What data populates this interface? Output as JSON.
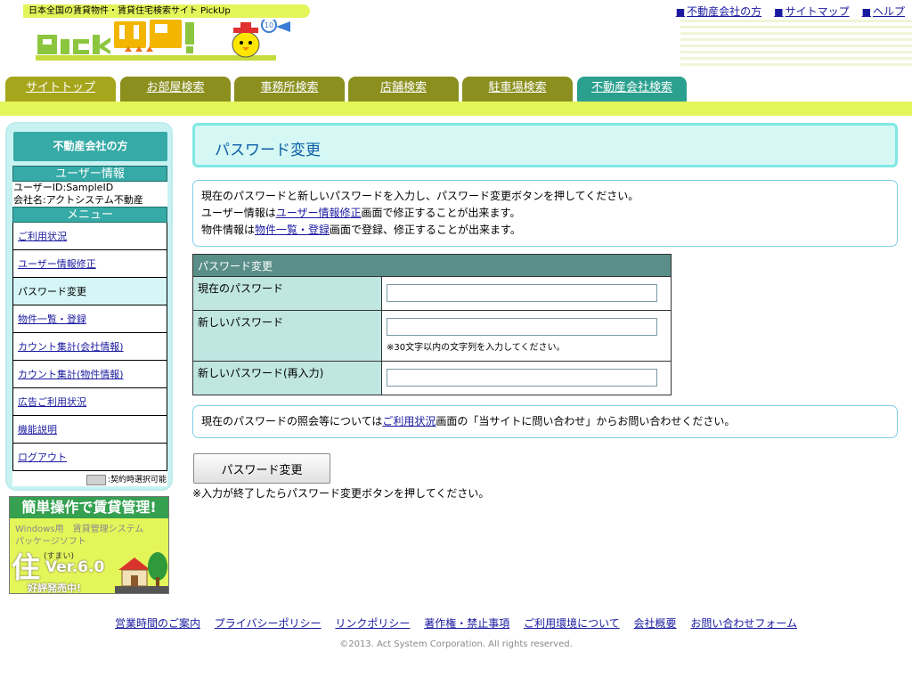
{
  "header": {
    "tagline": "日本全国の賃貸物件・賃貸住宅検索サイト PickUp",
    "top_links": [
      "不動産会社の方",
      "サイトマップ",
      "ヘルプ"
    ],
    "logo_text": "PickUp!",
    "mascot_badge": "10"
  },
  "tabs": [
    "サイトトップ",
    "お部屋検索",
    "事務所検索",
    "店舗検索",
    "駐車場検索",
    "不動産会社検索"
  ],
  "sidebar": {
    "heading": "不動産会社の方",
    "user_info_title": "ユーザー情報",
    "user_id": "ユーザーID:SampleID",
    "company": "会社名:アクトシステム不動産",
    "menu_title": "メニュー",
    "menu": [
      "ご利用状況",
      "ユーザー情報修正",
      "パスワード変更",
      "物件一覧・登録",
      "カウント集計(会社情報)",
      "カウント集計(物件情報)",
      "広告ご利用状況",
      "機能説明",
      "ログアウト"
    ],
    "legend": ":契約時選択可能"
  },
  "ad": {
    "title": "簡単操作で賃貸管理!",
    "sub1": "Windows用　賃貸管理システム",
    "sub2": "パッケージソフト",
    "kanji": "住",
    "ruby": "(すまい)",
    "version": "Ver.6.0",
    "sale": "好評発売中!"
  },
  "main": {
    "title": "パスワード変更",
    "info_line1": "現在のパスワードと新しいパスワードを入力し、パスワード変更ボタンを押してください。",
    "info_line2_pre": "ユーザー情報は",
    "info_line2_link": "ユーザー情報修正",
    "info_line2_post": "画面で修正することが出来ます。",
    "info_line3_pre": "物件情報は",
    "info_line3_link": "物件一覧・登録",
    "info_line3_post": "画面で登録、修正することが出来ます。",
    "table_header": "パスワード変更",
    "current_label": "現在のパスワード",
    "new_label": "新しいパスワード",
    "new_hint": "※30文字以内の文字列を入力してください。",
    "confirm_label": "新しいパスワード(再入力)",
    "current_value": "",
    "new_value": "",
    "confirm_value": "",
    "note_pre": "現在のパスワードの照会等については",
    "note_link": "ご利用状況",
    "note_post": "画面の「当サイトに問い合わせ」からお問い合わせください。",
    "submit_label": "パスワード変更",
    "submit_note": "※入力が終了したらパスワード変更ボタンを押してください。"
  },
  "footer": {
    "links": [
      "営業時間のご案内",
      "プライバシーポリシー",
      "リンクポリシー",
      "著作権・禁止事項",
      "ご利用環境について",
      "会社概要",
      "お問い合わせフォーム"
    ],
    "copyright": "©2013. Act System Corporation. All rights reserved."
  },
  "colors": {
    "accent_yellow": "#e4f55a",
    "tab_olive": "#8a8f1e",
    "tab_active": "#2ba08e",
    "teal": "#36aaa6",
    "light_cyan": "#c8f2f2"
  }
}
